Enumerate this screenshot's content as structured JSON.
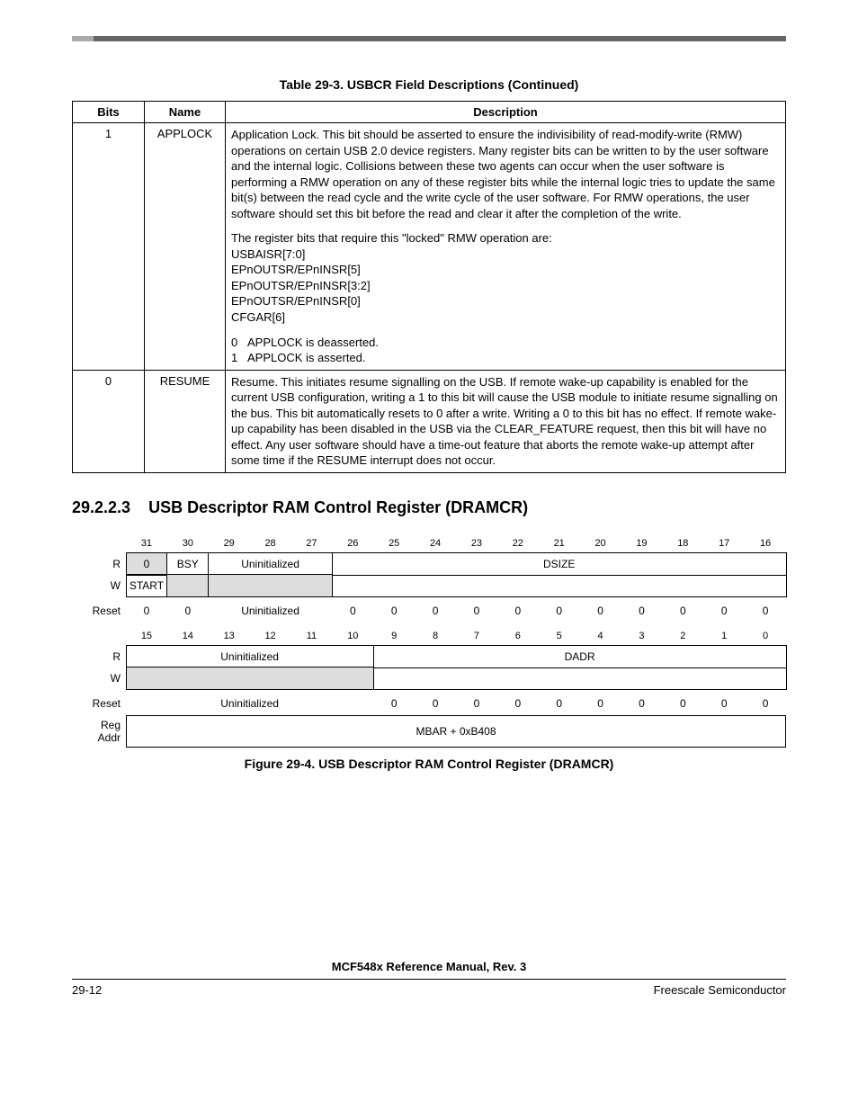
{
  "top_table": {
    "title": "Table 29-3. USBCR Field Descriptions (Continued)",
    "headers": {
      "bits": "Bits",
      "name": "Name",
      "desc": "Description"
    },
    "rows": [
      {
        "bits": "1",
        "name": "APPLOCK",
        "p1": "Application Lock. This bit should be asserted to ensure the indivisibility of read-modify-write (RMW) operations on certain USB 2.0 device registers.  Many register bits can be written to by the user software and the internal logic. Collisions between these two agents can occur when the user software is performing a RMW operation on any of these register bits while the internal logic tries to update the same bit(s) between the read cycle and the write cycle of the user software.  For RMW operations, the user software should set this bit before the read and clear it after the completion of the write.",
        "p2": "The register bits that require this \"locked\" RMW operation are:",
        "lines": [
          "USBAISR[7:0]",
          "EPnOUTSR/EPnINSR[5]",
          "EPnOUTSR/EPnINSR[3:2]",
          "EPnOUTSR/EPnINSR[0]",
          "CFGAR[6]"
        ],
        "enum": [
          {
            "k": "0",
            "v": "APPLOCK is deasserted."
          },
          {
            "k": "1",
            "v": "APPLOCK is asserted."
          }
        ]
      },
      {
        "bits": "0",
        "name": "RESUME",
        "p1": "Resume. This initiates resume signalling on the USB. If remote wake-up capability is enabled for the current USB configuration, writing a 1 to this bit will cause the USB module to initiate resume signalling on the bus. This bit automatically resets to 0 after a write. Writing a 0 to this bit has no effect. If remote wake-up capability has been disabled in the USB via the CLEAR_FEATURE request, then this bit will have no effect. Any user software should have a time-out feature that aborts the remote wake-up attempt after some time if the RESUME interrupt does not occur."
      }
    ]
  },
  "section": {
    "number": "29.2.2.3",
    "title": "USB Descriptor RAM Control Register (DRAMCR)"
  },
  "reg": {
    "bit_hi": [
      "31",
      "30",
      "29",
      "28",
      "27",
      "26",
      "25",
      "24",
      "23",
      "22",
      "21",
      "20",
      "19",
      "18",
      "17",
      "16"
    ],
    "bit_lo": [
      "15",
      "14",
      "13",
      "12",
      "11",
      "10",
      "9",
      "8",
      "7",
      "6",
      "5",
      "4",
      "3",
      "2",
      "1",
      "0"
    ],
    "labels": {
      "R": "R",
      "W": "W",
      "Reset": "Reset",
      "RegAddr": "Reg\nAddr"
    },
    "r1_31": "0",
    "r1_30": "BSY",
    "r1_uninit": "Uninitialized",
    "r1_dsize": "DSIZE",
    "w1_31": "START",
    "reset1": [
      "0",
      "0",
      "Uninitialized",
      "0",
      "0",
      "0",
      "0",
      "0",
      "0",
      "0",
      "0",
      "0",
      "0",
      "0"
    ],
    "r2_uninit": "Uninitialized",
    "r2_dadr": "DADR",
    "reset2_left": "Uninitialized",
    "reset2_right": [
      "0",
      "0",
      "0",
      "0",
      "0",
      "0",
      "0",
      "0",
      "0",
      "0"
    ],
    "reg_addr": "MBAR + 0xB408",
    "caption": "Figure 29-4. USB Descriptor RAM Control Register (DRAMCR)"
  },
  "footer": {
    "title": "MCF548x Reference Manual, Rev. 3",
    "left": "29-12",
    "right": "Freescale Semiconductor"
  }
}
